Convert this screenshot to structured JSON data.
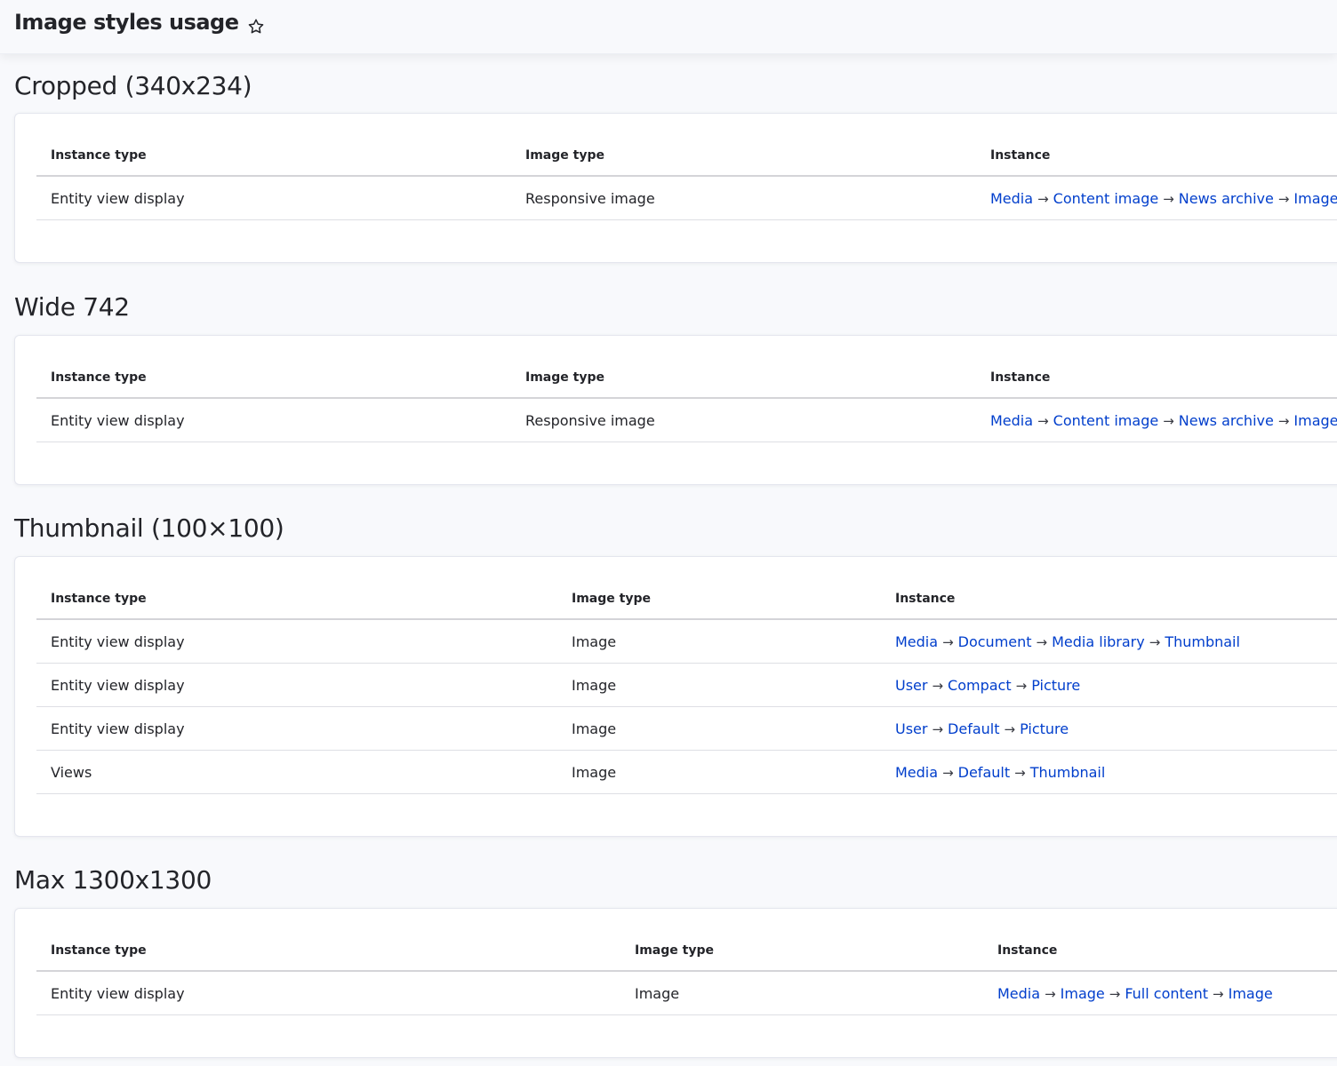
{
  "page": {
    "title": "Image styles usage"
  },
  "columns": {
    "instance_type": "Instance type",
    "image_type": "Image type",
    "instance": "Instance"
  },
  "sections": [
    {
      "title": "Cropped (340x234)",
      "rows": [
        {
          "instance_type": "Entity view display",
          "image_type": "Responsive image",
          "instance": [
            "Media",
            "Content image",
            "News archive",
            "Image"
          ]
        }
      ]
    },
    {
      "title": "Wide 742",
      "rows": [
        {
          "instance_type": "Entity view display",
          "image_type": "Responsive image",
          "instance": [
            "Media",
            "Content image",
            "News archive",
            "Image"
          ]
        }
      ]
    },
    {
      "title": "Thumbnail (100×100)",
      "rows": [
        {
          "instance_type": "Entity view display",
          "image_type": "Image",
          "instance": [
            "Media",
            "Document",
            "Media library",
            "Thumbnail"
          ]
        },
        {
          "instance_type": "Entity view display",
          "image_type": "Image",
          "instance": [
            "User",
            "Compact",
            "Picture"
          ]
        },
        {
          "instance_type": "Entity view display",
          "image_type": "Image",
          "instance": [
            "User",
            "Default",
            "Picture"
          ]
        },
        {
          "instance_type": "Views",
          "image_type": "Image",
          "instance": [
            "Media",
            "Default",
            "Thumbnail"
          ]
        }
      ]
    },
    {
      "title": "Max 1300x1300",
      "rows": [
        {
          "instance_type": "Entity view display",
          "image_type": "Image",
          "instance": [
            "Media",
            "Image",
            "Full content",
            "Image"
          ]
        }
      ]
    }
  ],
  "icons": {
    "favorite": "star-outline-icon",
    "separator": "arrow-right-icon"
  },
  "colors": {
    "link": "#003ecc",
    "background": "#f8f9fc",
    "card": "#ffffff"
  }
}
